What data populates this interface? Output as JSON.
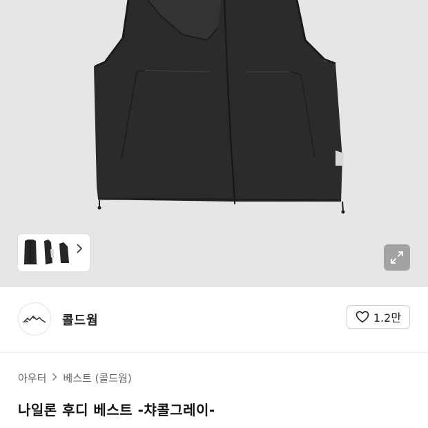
{
  "gallery": {
    "background_color": "#e6e6e6",
    "product_image": "black-nylon-vest",
    "thumbnails": [
      "vest-front",
      "vest-side",
      "vest-back"
    ],
    "next_icon": "chevron-right-icon",
    "expand_icon": "expand-icon"
  },
  "seller": {
    "name": "콜드웜",
    "avatar_icon": "mountain-logo-icon",
    "like_icon": "heart-outline-icon",
    "like_count": "1.2만"
  },
  "breadcrumb": {
    "category": "아우터",
    "subcategory": "베스트 (콜드웜)"
  },
  "product": {
    "title": "나일론 후디 베스트 -챠콜그레이-"
  }
}
